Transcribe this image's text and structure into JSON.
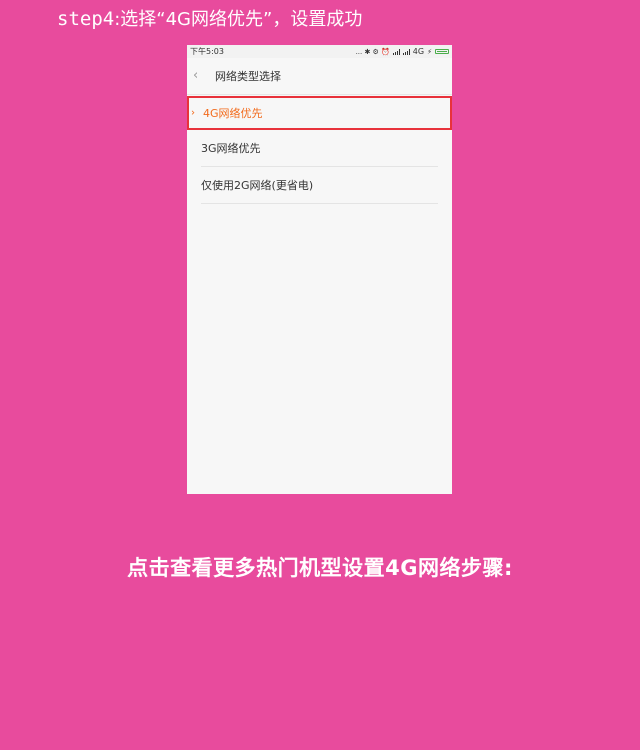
{
  "step": {
    "lead": "step4",
    "text": ":选择“4G网络优先”，设置成功"
  },
  "phone": {
    "status": {
      "time": "下午5:03",
      "indicators": "... ✱ ⚙ ⏰",
      "network": "4G",
      "charge": "⚡"
    },
    "nav": {
      "back_icon": "‹",
      "title": "网络类型选择"
    },
    "options": [
      {
        "label": "4G网络优先",
        "selected": true
      },
      {
        "label": "3G网络优先",
        "selected": false
      },
      {
        "label": "仅使用2G网络(更省电)",
        "selected": false
      }
    ],
    "selected_icon": "›"
  },
  "footer": {
    "heading": "点击查看更多热门机型设置4G网络步骤:"
  },
  "colors": {
    "background": "#e84b9d",
    "selected_text": "#f26b1d",
    "highlight_border": "#e8323b"
  }
}
